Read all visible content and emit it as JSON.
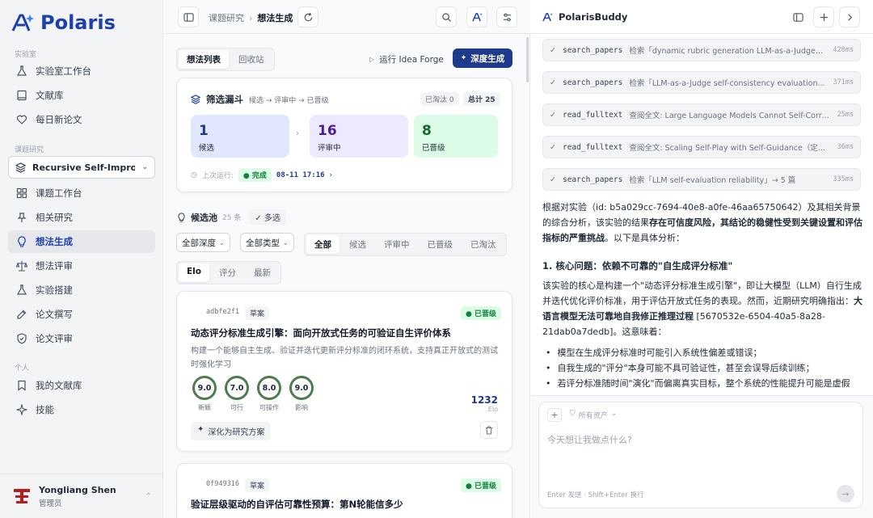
{
  "app": {
    "name": "Polaris"
  },
  "sidebar": {
    "section_lab": "实验室",
    "lab_items": [
      {
        "label": "实验室工作台",
        "icon": "flask-icon"
      },
      {
        "label": "文献库",
        "icon": "book-icon"
      },
      {
        "label": "每日新论文",
        "icon": "heart-icon"
      }
    ],
    "section_project": "课题研究",
    "project_select": "Recursive Self-Improv...",
    "project_items": [
      {
        "label": "课题工作台",
        "icon": "grid-icon"
      },
      {
        "label": "相关研究",
        "icon": "pin-icon"
      },
      {
        "label": "想法生成",
        "icon": "bulb-icon",
        "active": true
      },
      {
        "label": "想法评审",
        "icon": "scale-icon"
      },
      {
        "label": "实验搭建",
        "icon": "flask-icon"
      },
      {
        "label": "论文撰写",
        "icon": "edit-icon"
      },
      {
        "label": "论文评审",
        "icon": "shield-icon"
      }
    ],
    "section_personal": "个人",
    "personal_items": [
      {
        "label": "我的文献库",
        "icon": "bookmark-icon"
      },
      {
        "label": "技能",
        "icon": "sparkle-icon"
      }
    ],
    "user": {
      "name": "Yongliang Shen",
      "role": "管理员"
    }
  },
  "main": {
    "breadcrumb": {
      "parent": "课题研究",
      "current": "想法生成"
    },
    "tabs": [
      "想法列表",
      "回收站"
    ],
    "run_label": "运行 Idea Forge",
    "deep_label": "深度生成",
    "funnel": {
      "title": "筛选漏斗",
      "flow": "候选 → 评审中 → 已晋级",
      "eliminated": "已淘汰 0",
      "total": "总计 25",
      "stages": [
        {
          "num": "1",
          "label": "候选"
        },
        {
          "num": "16",
          "label": "评审中"
        },
        {
          "num": "8",
          "label": "已晋级"
        }
      ],
      "last_run_label": "上次运行:",
      "status": "完成",
      "time": "08-11 17:16"
    },
    "pool": {
      "title": "候选池",
      "count": "25 条",
      "multi": "多选"
    },
    "filters": {
      "depth": "全部深度",
      "type": "全部类型",
      "status_tabs": [
        "全部",
        "候选",
        "评审中",
        "已晋级",
        "已淘汰"
      ],
      "sort_tabs": [
        "Elo",
        "评分",
        "最新"
      ]
    },
    "ideas": [
      {
        "id": "adbfe2f1",
        "tag": "草案",
        "status": "已晋级",
        "title": "动态评分标准生成引擎：面向开放式任务的可验证自生评价体系",
        "desc": "构建一个能够自主生成、验证并迭代更新评分标准的闭环系统，支持真正开放式的测试时强化学习",
        "scores": [
          {
            "v": "9.0",
            "label": "新颖"
          },
          {
            "v": "7.0",
            "label": "可行"
          },
          {
            "v": "8.0",
            "label": "可操作"
          },
          {
            "v": "9.0",
            "label": "影响"
          }
        ],
        "elo": "1232",
        "elo_label": "Elo",
        "action": "深化为研究方案"
      },
      {
        "id": "0f949316",
        "tag": "草案",
        "status": "已晋级",
        "title": "验证层级驱动的自评估可靠性预算：第N轮能信多少"
      }
    ]
  },
  "assistant": {
    "title": "PolarisBuddy",
    "tools": [
      {
        "name": "search_papers",
        "desc": "检索「dynamic rubric generation LLM-as-a-Judge」...",
        "time": "428ms"
      },
      {
        "name": "search_papers",
        "desc": "检索「LLM-as-a-Judge self-consistency evaluation...",
        "time": "371ms"
      },
      {
        "name": "read_fulltext",
        "desc": "查阅全文: Large Language Models Cannot Self-Corre...",
        "time": "25ms"
      },
      {
        "name": "read_fulltext",
        "desc": "查阅全文: Scaling Self-Play with Self-Guidance（定...",
        "time": "36ms"
      },
      {
        "name": "search_papers",
        "desc": "检索「LLM self-evaluation reliability」→ 5 篇",
        "time": "335ms"
      }
    ],
    "intro_a": "根据对实验（id: b5a029cc-7694-40e8-a0fe-46aa65750642）及其相关背景的综合分析，该实验的结果",
    "intro_b": "存在可信度风险，其结论的稳健性受到关键设置和评估指标的严重挑战",
    "intro_c": "。以下是具体分析：",
    "heading": "1. 核心问题：依赖不可靠的\"自生成评分标准\"",
    "body_a": "该实验的核心是构建一个\"动态评分标准生成引擎\"，即让大模型（LLM）自行生成并迭代优化评价标准，用于评估开放式任务的表现。然而，近期研究明确指出：",
    "body_b": "大语言模型无法可靠地自我修正推理过程",
    "body_c": " [5670532e-6504-40a5-8a28-21dab0a7dedb]。这意味着：",
    "bullets": [
      "模型在生成评分标准时可能引入系统性偏差或错误；",
      "自我生成的\"评分\"本身可能不具可验证性，甚至会误导后续训练；",
      "若评分标准随时间\"演化\"而偏离真实目标，整个系统的性能提升可能是虚假"
    ],
    "composer": {
      "scope": "所有资产",
      "placeholder": "今天想让我做点什么?",
      "hint": "Enter 发送 · Shift+Enter 换行"
    }
  },
  "colors": {
    "brand": "#1e40af",
    "primary": "#1e3a8a",
    "promoted": "#15803d"
  }
}
